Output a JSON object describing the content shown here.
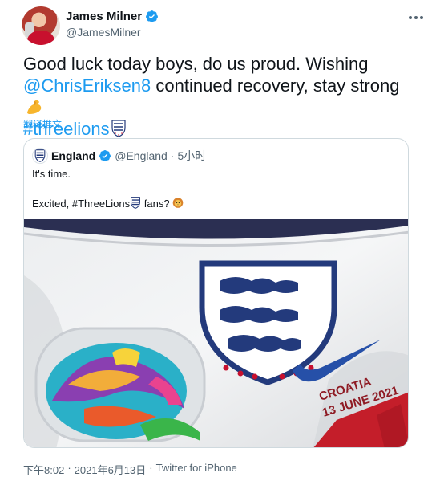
{
  "author": {
    "name": "James Milner",
    "handle": "@JamesMilner",
    "verified": true
  },
  "tweet": {
    "text_before": "Good luck today boys, do us proud. Wishing ",
    "mention": "@ChrisEriksen8",
    "text_middle": " continued recovery, stay strong ",
    "hashtag": "#threelions",
    "emojis": [
      "flexed-biceps",
      "england-crest"
    ],
    "translate_label": "翻译推文"
  },
  "quoted_tweet": {
    "name": "England",
    "handle": "@England",
    "separator": "·",
    "time": "5小时",
    "line1": "It's time.",
    "line2_before": "Excited, ",
    "line2_hashtag": "#ThreeLions",
    "line2_after": " fans? ",
    "image_text_country": "CROATIA",
    "image_text_date": "13 JUNE 2021"
  },
  "footer": {
    "time": "下午8:02",
    "sep1": "·",
    "date": "2021年6月13日",
    "sep2": "·",
    "source": "Twitter for iPhone"
  },
  "colors": {
    "link": "#1d9bf0",
    "secondary_text": "#536471",
    "border": "#cfd9de",
    "verified_badge": "#1d9bf0"
  }
}
